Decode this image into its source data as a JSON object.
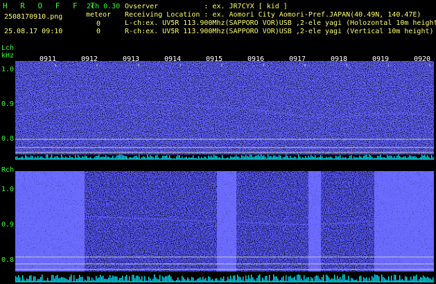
{
  "header": {
    "app_name": "H R O F F T",
    "mode": "2ch 0.30",
    "filename": "2508170910.png",
    "detect_label": "meteor",
    "count_l": "0",
    "datetime": "25.08.17 09:10",
    "count_r": "0",
    "observer": "Ovserver           : ex. JR7CYX [ kid ]",
    "location": "Receiving Location : ex. Aomori City Aomori-Pref.JAPAN(40.49N, 140.47E)",
    "lch_info": "L-ch:ex. UV5R 113.900Mhz(SAPPORO VOR)USB ,2-ele yagi (Holozontal 10m height)",
    "rch_info": "R-ch:ex. UV5R 113.900Mhz(SAPPORO VOR)USB ,2-ele yagi (Vertical 10m height)"
  },
  "lch": {
    "label": "Lch",
    "unit": "kHz",
    "yticks": [
      "1.0",
      "0.9",
      "0.8"
    ],
    "time_labels": [
      "0911",
      "0912",
      "0913",
      "0914",
      "0915",
      "0916",
      "0917",
      "0918",
      "0919",
      "0920"
    ]
  },
  "rch": {
    "label": "Rch",
    "yticks": [
      "1.0",
      "0.9",
      "0.8"
    ]
  },
  "colors": {
    "background": "#000000",
    "text_green": "#33ff33",
    "text_yellow": "#ffff66",
    "noise": "#1a1aff",
    "signal": "#6666ff",
    "level": "#00e5ff",
    "gridline": "#c8c8c8"
  }
}
